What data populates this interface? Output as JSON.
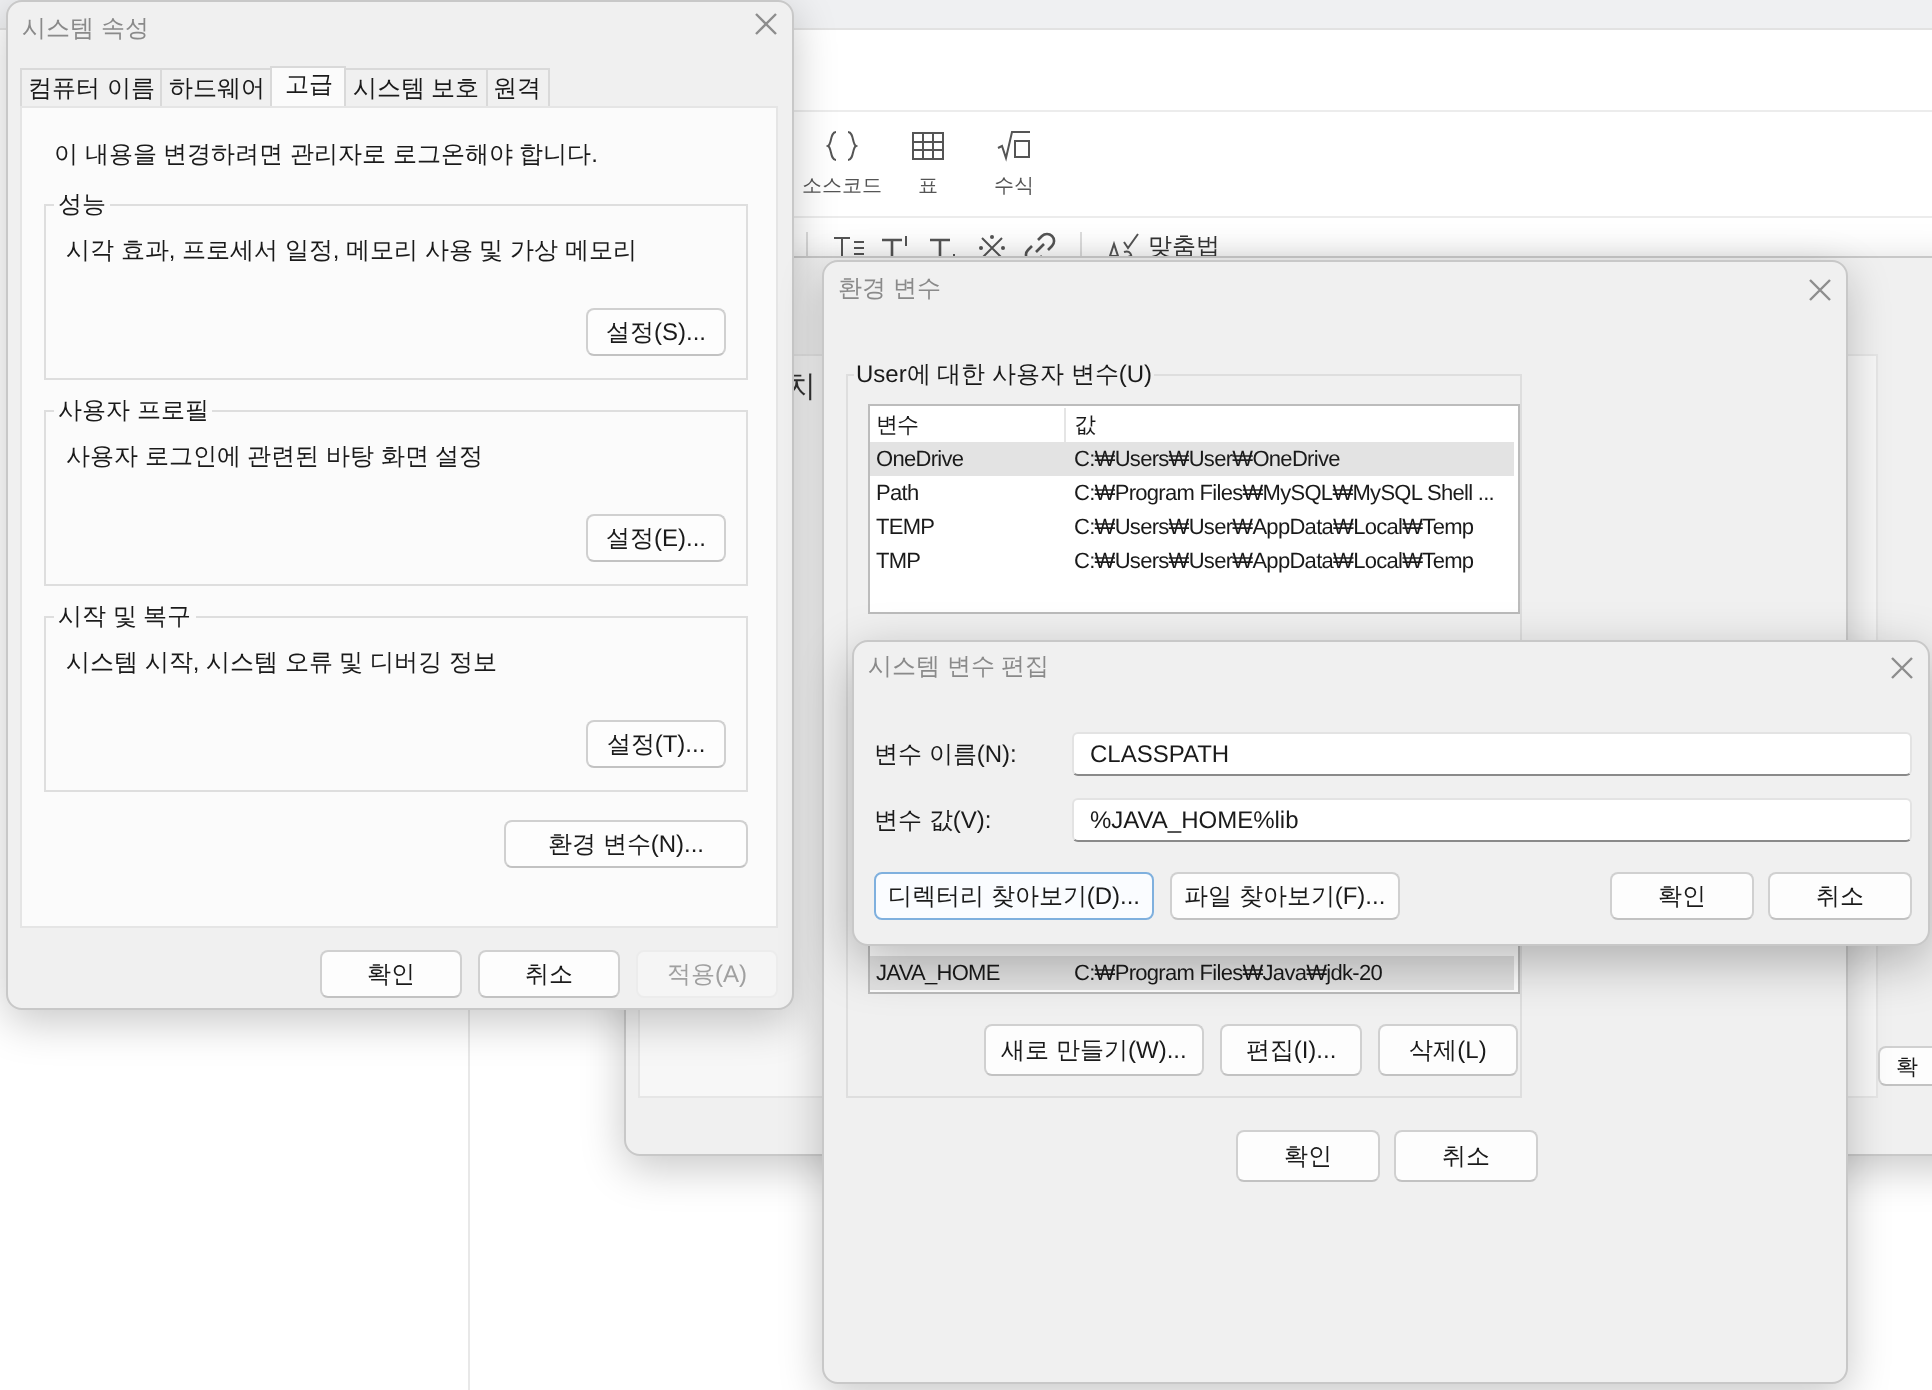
{
  "editor": {
    "insert_tools": [
      {
        "label": "소스코드",
        "kind": "code"
      },
      {
        "label": "표",
        "kind": "table"
      },
      {
        "label": "수식",
        "kind": "formula"
      }
    ],
    "format_tools": [
      {
        "kind": "text-style"
      },
      {
        "kind": "superscript"
      },
      {
        "kind": "subscript"
      },
      {
        "kind": "reference-mark"
      },
      {
        "kind": "link"
      }
    ],
    "spellcheck": "맞춤법"
  },
  "behind_window": {
    "heading": "치",
    "button": "확"
  },
  "system_properties": {
    "title": "시스템 속성",
    "tabs": [
      {
        "label": "컴퓨터 이름",
        "selected": false
      },
      {
        "label": "하드웨어",
        "selected": false
      },
      {
        "label": "고급",
        "selected": true
      },
      {
        "label": "시스템 보호",
        "selected": false
      },
      {
        "label": "원격",
        "selected": false
      }
    ],
    "notice": "이 내용을 변경하려면 관리자로 로그온해야 합니다.",
    "groups": [
      {
        "title": "성능",
        "description": "시각 효과, 프로세서 일정, 메모리 사용 및 가상 메모리",
        "button": "설정(S)..."
      },
      {
        "title": "사용자 프로필",
        "description": "사용자 로그인에 관련된 바탕 화면 설정",
        "button": "설정(E)..."
      },
      {
        "title": "시작 및 복구",
        "description": "시스템 시작, 시스템 오류 및 디버깅 정보",
        "button": "설정(T)..."
      }
    ],
    "env_button": "환경 변수(N)...",
    "buttons": [
      {
        "label": "확인",
        "disabled": false
      },
      {
        "label": "취소",
        "disabled": false
      },
      {
        "label": "적용(A)",
        "disabled": true
      }
    ]
  },
  "environment_variables": {
    "title": "환경 변수",
    "group_title": "User에 대한 사용자 변수(U)",
    "columns": [
      "변수",
      "값"
    ],
    "user_rows": [
      {
        "name": "OneDrive",
        "value": "C:₩Users₩User₩OneDrive",
        "selected": true
      },
      {
        "name": "Path",
        "value": "C:₩Program Files₩MySQL₩MySQL Shell ...",
        "selected": false
      },
      {
        "name": "TEMP",
        "value": "C:₩Users₩User₩AppData₩Local₩Temp",
        "selected": false
      },
      {
        "name": "TMP",
        "value": "C:₩Users₩User₩AppData₩Local₩Temp",
        "selected": false
      }
    ],
    "system_rows": [
      {
        "name": "JAVA_HOME",
        "value": "C:₩Program Files₩Java₩jdk-20",
        "selected": true
      }
    ],
    "list_buttons": [
      "새로 만들기(W)...",
      "편집(I)...",
      "삭제(L)"
    ],
    "buttons": [
      "확인",
      "취소"
    ]
  },
  "edit_variable": {
    "title": "시스템 변수 편집",
    "fields": [
      {
        "label": "변수 이름(N):",
        "value": "CLASSPATH"
      },
      {
        "label": "변수 값(V):",
        "value": "%JAVA_HOME%lib"
      }
    ],
    "browse_buttons": [
      {
        "label": "디렉터리 찾아보기(D)...",
        "focused": true
      },
      {
        "label": "파일 찾아보기(F)...",
        "focused": false
      }
    ],
    "buttons": [
      {
        "label": "확인",
        "focused": false
      },
      {
        "label": "취소",
        "focused": false
      }
    ]
  }
}
